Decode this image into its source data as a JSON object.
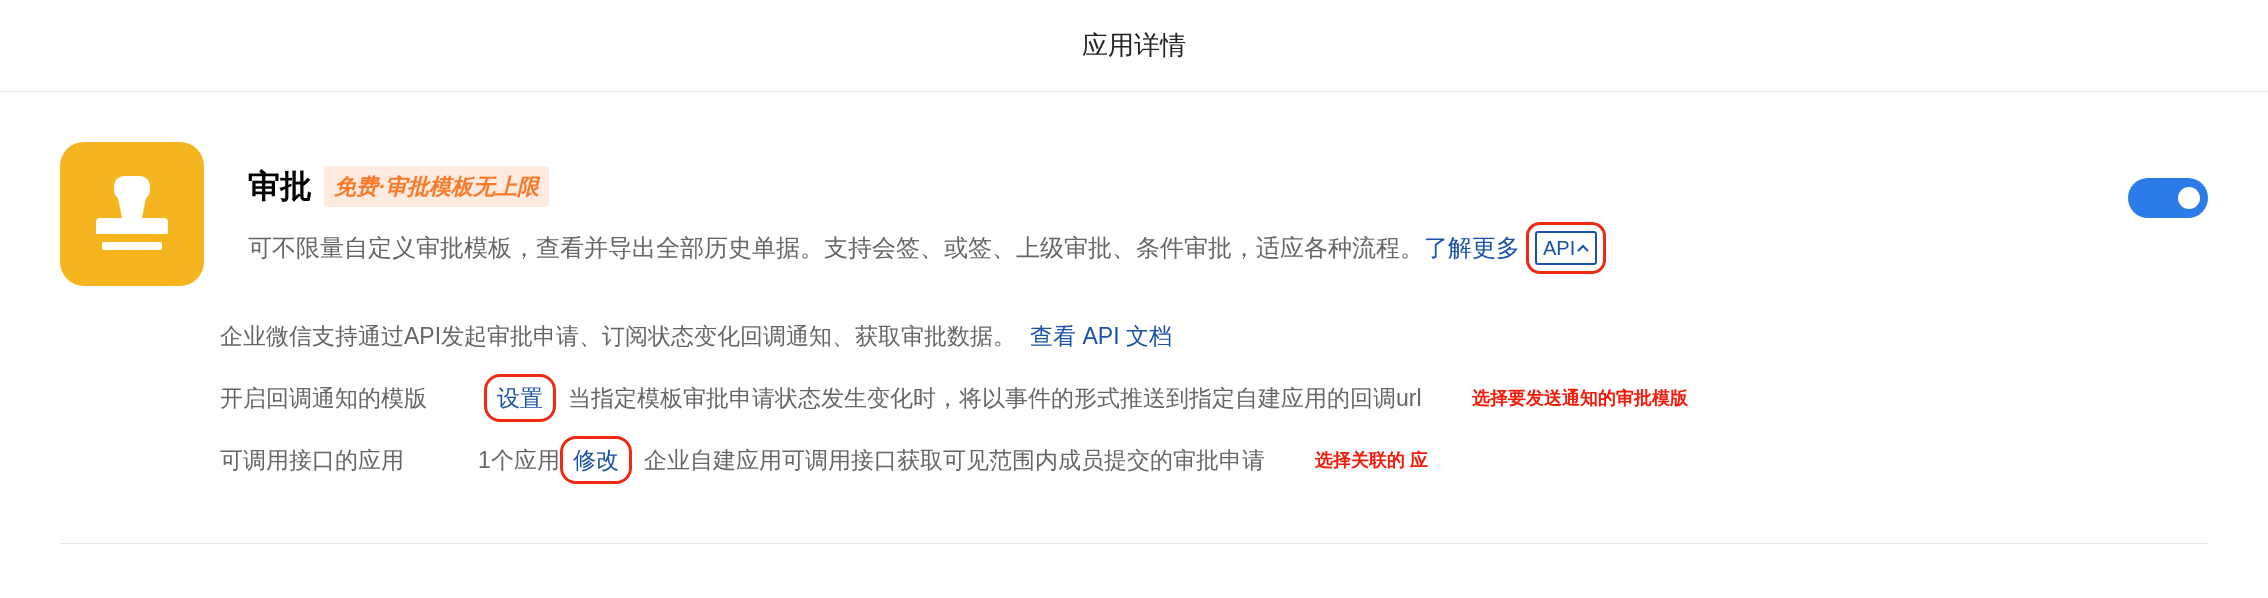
{
  "header": {
    "title": "应用详情"
  },
  "app": {
    "name": "审批",
    "badge": "免费·审批模板无上限",
    "description": "可不限量自定义审批模板，查看并导出全部历史单据。支持会签、或签、上级审批、条件审批，适应各种流程。",
    "learn_more": "了解更多",
    "api_toggle": {
      "label": "API",
      "expanded": true,
      "highlighted": true
    },
    "enabled": true
  },
  "api_intro": {
    "text": "企业微信支持通过API发起审批申请、订阅状态变化回调通知、获取审批数据。",
    "link": "查看 API 文档"
  },
  "settings": [
    {
      "label": "开启回调通知的模版",
      "action": {
        "label": "设置",
        "highlighted": true
      },
      "description": "当指定模板审批申请状态发生变化时，将以事件的形式推送到指定自建应用的回调url",
      "annotation": "选择要发送通知的审批模版"
    },
    {
      "label": "可调用接口的应用",
      "value": "1个应用",
      "action": {
        "label": "修改",
        "highlighted": true
      },
      "description": "企业自建应用可调用接口获取可见范围内成员提交的审批申请",
      "annotation": "选择关联的 应"
    }
  ]
}
